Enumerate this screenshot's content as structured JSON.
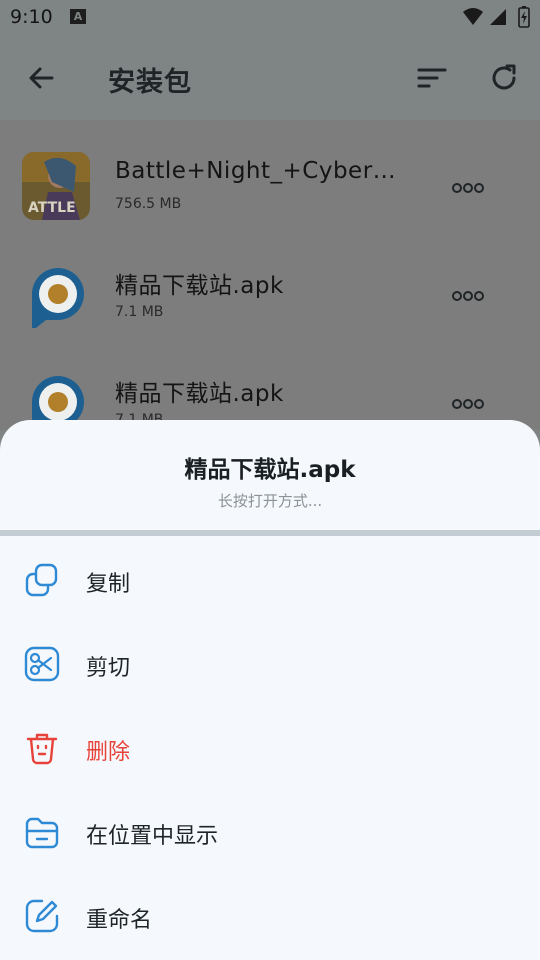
{
  "status_bar": {
    "time": "9:10",
    "notification_glyph": "A"
  },
  "app_bar": {
    "title": "安装包"
  },
  "files": [
    {
      "name": "Battle+Night_+Cyber…",
      "size": "756.5 MB",
      "icon": "game-icon"
    },
    {
      "name": "精品下载站.apk",
      "size": "7.1 MB",
      "icon": "p-logo-icon"
    },
    {
      "name": "精品下载站.apk",
      "size": "7.1 MB",
      "icon": "p-logo-icon"
    }
  ],
  "sheet": {
    "title": "精品下载站.apk",
    "subtitle": "长按打开方式...",
    "items": [
      {
        "label": "复制",
        "icon": "copy-icon"
      },
      {
        "label": "剪切",
        "icon": "scissors-icon"
      },
      {
        "label": "删除",
        "icon": "trash-icon",
        "color": "#e8433b"
      },
      {
        "label": "在位置中显示",
        "icon": "folder-icon"
      },
      {
        "label": "重命名",
        "icon": "edit-icon"
      }
    ]
  },
  "colors": {
    "accent": "#2f8ad6",
    "danger": "#e8433b",
    "scrim": "#7f8485",
    "sheet_bg": "#f5f8fc"
  }
}
